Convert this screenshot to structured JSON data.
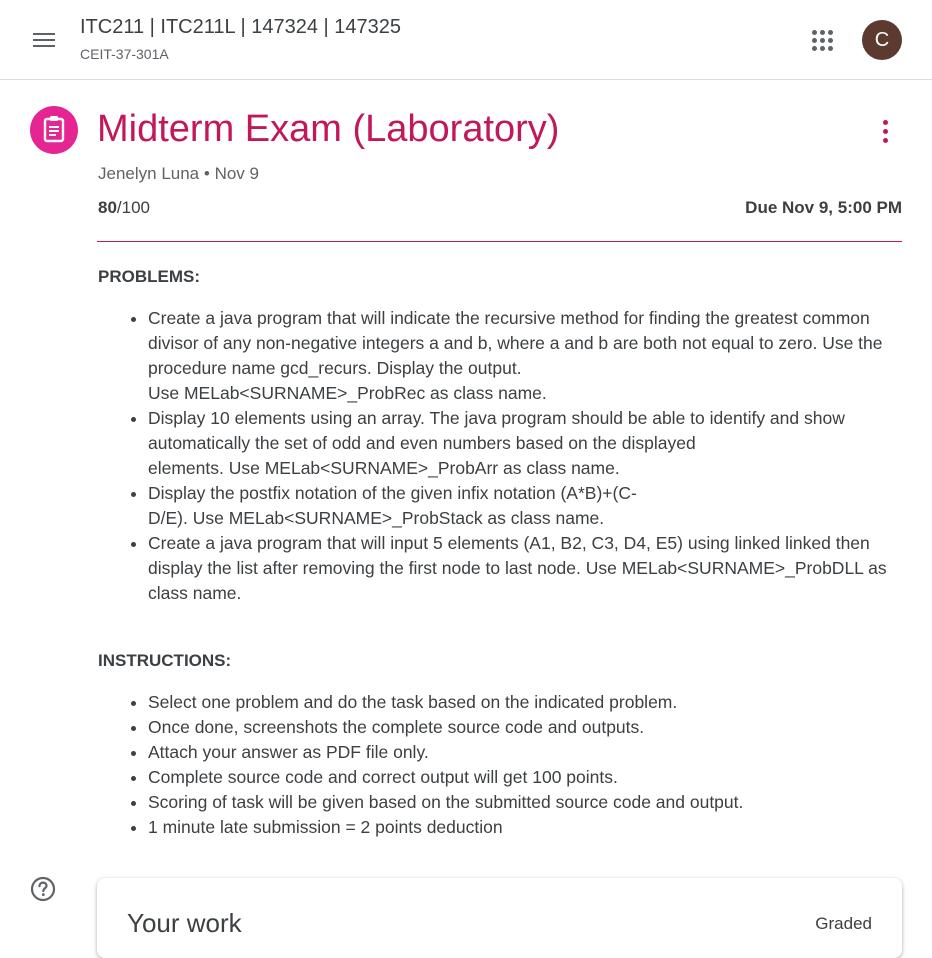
{
  "header": {
    "course_title": "ITC211 | ITC211L | 147324 | 147325",
    "section": "CEIT-37-301A",
    "avatar_letter": "C",
    "icons": [
      "menu-icon",
      "apps-icon"
    ]
  },
  "assignment": {
    "title": "Midterm Exam (Laboratory)",
    "author": "Jenelyn Luna",
    "posted": "Nov 9",
    "points_earned": "80",
    "points_total": "/100",
    "due": "Due Nov 9, 5:00 PM",
    "accent_color": "#c2185b"
  },
  "problems": {
    "heading": "PROBLEMS:",
    "items": [
      "Create a java program that will indicate the recursive method for finding the greatest common divisor of any non-negative integers a and b, where a and b are both not equal to zero. Use the procedure name gcd_recurs. Display the output.\nUse  MELab<SURNAME>_ProbRec as class name.",
      "Display 10 elements using an array. The java program should be able to identify and show automatically the set of odd and even numbers based on the displayed\nelements. Use  MELab<SURNAME>_ProbArr as class name.",
      "Display the postfix notation of the given infix notation (A*B)+(C-\nD/E). Use  MELab<SURNAME>_ProbStack as class name.",
      "Create a java program that will input 5 elements (A1, B2, C3, D4, E5) using linked linked then display the list after removing the first node to last node. Use  MELab<SURNAME>_ProbDLL as class name."
    ]
  },
  "instructions": {
    "heading": "INSTRUCTIONS:",
    "items": [
      "Select one problem and do the task based on the indicated problem.",
      "Once done, screenshots the complete source code and outputs.",
      "Attach your answer as PDF file only.",
      "Complete source code and correct output will get 100 points.",
      "Scoring of task will be given based on the submitted source code and output.",
      "1 minute late submission = 2 points deduction"
    ]
  },
  "your_work": {
    "title": "Your work",
    "status": "Graded"
  }
}
